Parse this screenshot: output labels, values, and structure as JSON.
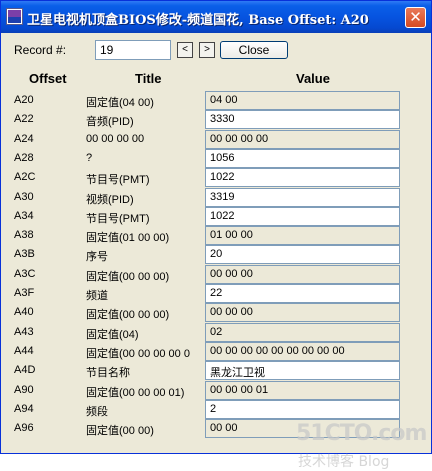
{
  "window": {
    "title": "卫星电视机顶盒BIOS修改-频道国花, Base Offset: A20",
    "close_glyph": "✕"
  },
  "form": {
    "record_label": "Record #:",
    "record_value": "19",
    "prev_label": "<",
    "next_label": ">",
    "close_label": "Close"
  },
  "headers": {
    "offset": "Offset",
    "title": "Title",
    "value": "Value"
  },
  "rows": [
    {
      "offset": "A20",
      "title": "固定值(04 00)",
      "value": "04 00",
      "editable": false
    },
    {
      "offset": "A22",
      "title": "音频(PID)",
      "value": "3330",
      "editable": true
    },
    {
      "offset": "A24",
      "title": "00 00 00 00",
      "value": "00 00 00 00",
      "editable": false
    },
    {
      "offset": "A28",
      "title": "?",
      "value": "1056",
      "editable": true
    },
    {
      "offset": "A2C",
      "title": "节目号(PMT)",
      "value": "1022",
      "editable": true
    },
    {
      "offset": "A30",
      "title": "视频(PID)",
      "value": "3319",
      "editable": true
    },
    {
      "offset": "A34",
      "title": "节目号(PMT)",
      "value": "1022",
      "editable": true
    },
    {
      "offset": "A38",
      "title": "固定值(01 00 00)",
      "value": "01 00 00",
      "editable": false
    },
    {
      "offset": "A3B",
      "title": "序号",
      "value": "20",
      "editable": true
    },
    {
      "offset": "A3C",
      "title": "固定值(00 00 00)",
      "value": "00 00 00",
      "editable": false
    },
    {
      "offset": "A3F",
      "title": "频道",
      "value": "22",
      "editable": true
    },
    {
      "offset": "A40",
      "title": "固定值(00 00 00)",
      "value": "00 00 00",
      "editable": false
    },
    {
      "offset": "A43",
      "title": "固定值(04)",
      "value": "02",
      "editable": false
    },
    {
      "offset": "A44",
      "title": "固定值(00 00 00 00 0",
      "value": "00 00 00 00 00 00 00 00 00",
      "editable": false
    },
    {
      "offset": "A4D",
      "title": "节目名称",
      "value": "黑龙江卫视",
      "editable": true
    },
    {
      "offset": "A90",
      "title": "固定值(00 00 00 01)",
      "value": "00 00 00 01",
      "editable": false
    },
    {
      "offset": "A94",
      "title": "频段",
      "value": "2",
      "editable": true
    },
    {
      "offset": "A96",
      "title": "固定值(00 00)",
      "value": "00 00",
      "editable": false
    }
  ],
  "watermark": {
    "line1": "51CTO.com",
    "line2": "技术博客 Blog"
  }
}
